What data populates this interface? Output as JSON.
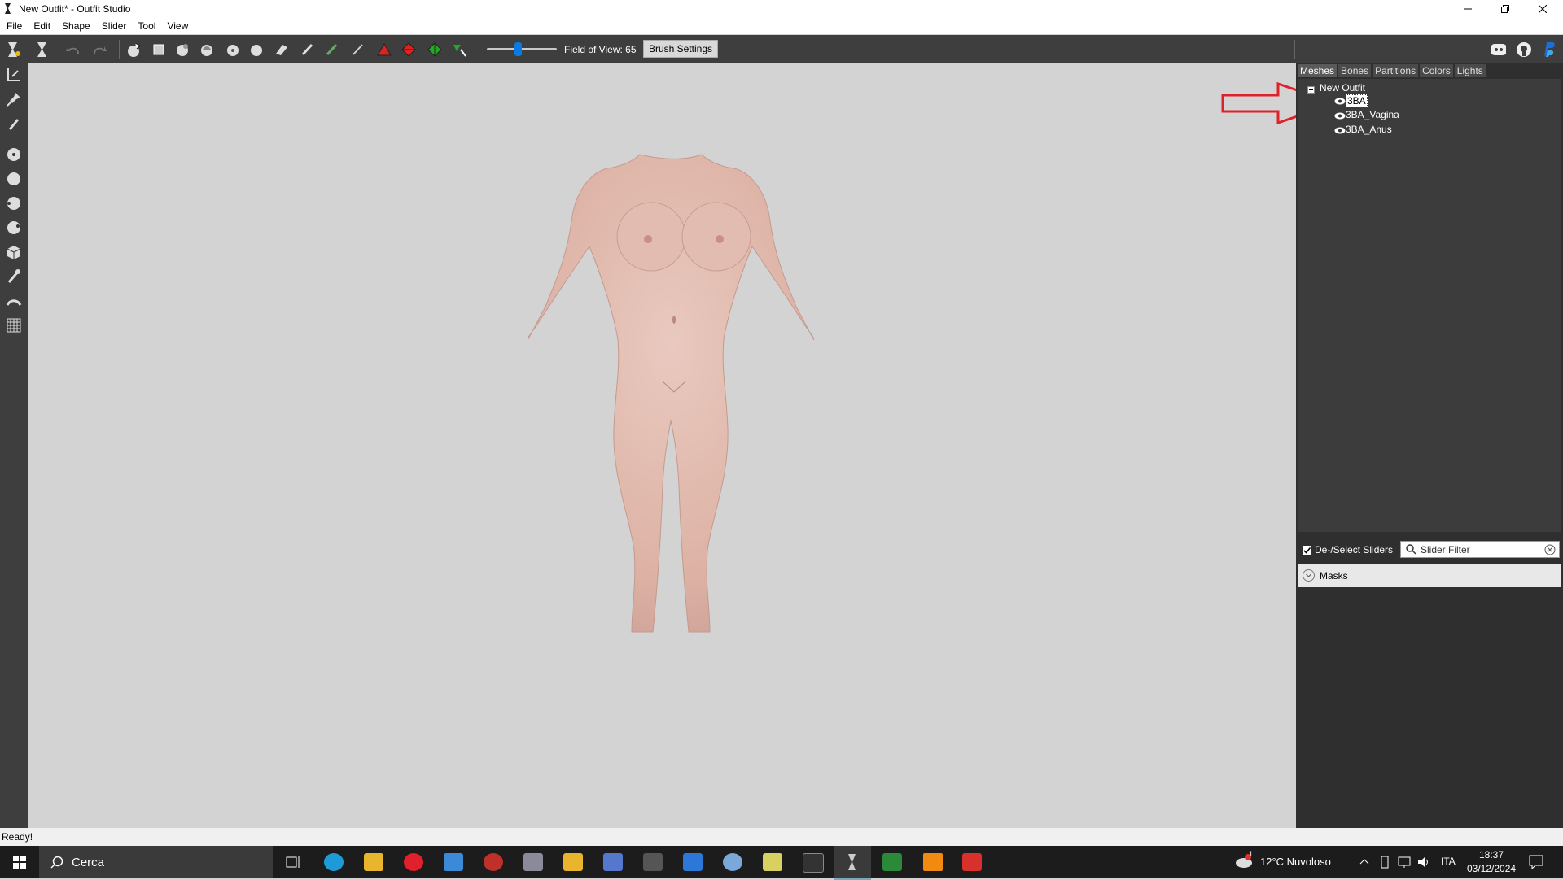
{
  "window": {
    "title": "New Outfit* - Outfit Studio"
  },
  "menu": [
    "File",
    "Edit",
    "Shape",
    "Slider",
    "Tool",
    "View"
  ],
  "toolbar": {
    "fov_label": "Field of View: 65",
    "fov_value": 65,
    "brush_settings_label": "Brush Settings"
  },
  "panel": {
    "tabs": [
      "Meshes",
      "Bones",
      "Partitions",
      "Colors",
      "Lights"
    ],
    "active_tab": "Meshes",
    "tree_root": "New Outfit",
    "meshes": [
      "3BA",
      "3BA_Vagina",
      "3BA_Anus"
    ],
    "selected_mesh": "3BA",
    "deselect_label": "De-/Select Sliders",
    "filter_placeholder": "Slider Filter",
    "masks_label": "Masks"
  },
  "status": {
    "text": "Ready!"
  },
  "taskbar": {
    "search_label": "Cerca",
    "weather": "12°C  Nuvoloso",
    "language": "ITA",
    "time": "18:37",
    "date": "03/12/2024",
    "notification_badge": "1"
  },
  "colors": {
    "toolbar_bg": "#3e3e3e",
    "panel_bg": "#2f2f2f",
    "viewport_bg": "#d3d3d3",
    "accent": "#0a7ae0",
    "annotation_arrow": "#e0202a"
  }
}
